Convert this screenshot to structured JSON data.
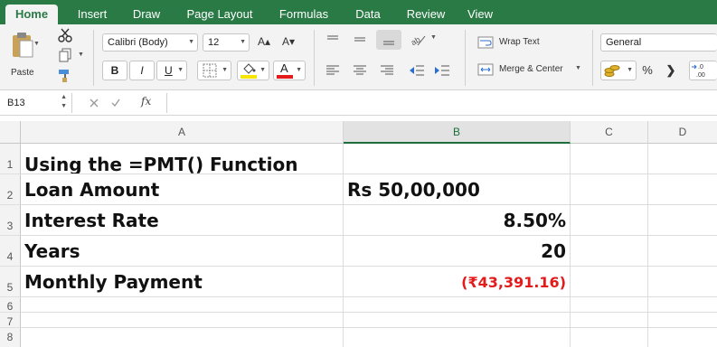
{
  "tabs": [
    {
      "label": "Home",
      "active": true
    },
    {
      "label": "Insert"
    },
    {
      "label": "Draw"
    },
    {
      "label": "Page Layout"
    },
    {
      "label": "Formulas"
    },
    {
      "label": "Data"
    },
    {
      "label": "Review"
    },
    {
      "label": "View"
    }
  ],
  "ribbon": {
    "paste_label": "Paste",
    "font_name": "Calibri (Body)",
    "font_size": "12",
    "grow_font": "A▴",
    "shrink_font": "A▾",
    "bold": "B",
    "italic": "I",
    "underline": "U",
    "font_color_letter": "A",
    "wrap_text": "Wrap Text",
    "merge_center": "Merge & Center",
    "number_format": "General",
    "percent": "%",
    "comma": "➔",
    "decimal": ".0\n.00",
    "fill_color": "#f7e400",
    "font_color": "#e31b1b"
  },
  "formula_bar": {
    "cell_ref": "B13",
    "fx": "fx",
    "formula": ""
  },
  "columns": [
    "A",
    "B",
    "C",
    "D"
  ],
  "rows": [
    {
      "num": "1",
      "a": "Using the =PMT() Function",
      "b": ""
    },
    {
      "num": "2",
      "a": "Loan Amount",
      "b": "Rs 50,00,000"
    },
    {
      "num": "3",
      "a": "Interest Rate",
      "b": "8.50%"
    },
    {
      "num": "4",
      "a": "Years",
      "b": "20"
    },
    {
      "num": "5",
      "a": "Monthly Payment",
      "b": "(₹43,391.16)"
    },
    {
      "num": "6",
      "a": "",
      "b": ""
    },
    {
      "num": "7",
      "a": "",
      "b": ""
    },
    {
      "num": "8",
      "a": "",
      "b": ""
    }
  ],
  "colors": {
    "accent": "#2a7a46",
    "negative": "#e31b1b"
  }
}
